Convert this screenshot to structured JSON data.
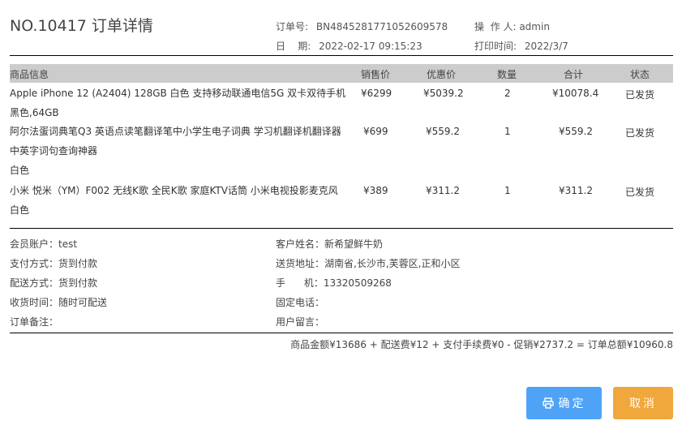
{
  "header": {
    "title": "NO.10417 订单详情",
    "order_no_label": "订单号:",
    "order_no": "BN4845281771052609578",
    "operator_label": "操  作 人:",
    "operator": "admin",
    "date_label": "日    期:",
    "date": "2022-02-17 09:15:23",
    "print_time_label": "打印时间:",
    "print_time": "2022/3/7"
  },
  "table": {
    "columns": [
      "商品信息",
      "销售价",
      "优惠价",
      "数量",
      "合计",
      "状态"
    ],
    "rows": [
      {
        "product_line1": "Apple iPhone 12 (A2404) 128GB 白色 支持移动联通电信5G 双卡双待手机",
        "product_line2": "黑色,64GB",
        "product_line3": "",
        "sale_price": "¥6299",
        "discount_price": "¥5039.2",
        "qty": "2",
        "total": "¥10078.4",
        "status": "已发货"
      },
      {
        "product_line1": "阿尔法蛋词典笔Q3 英语点读笔翻译笔中小学生电子词典 学习机翻译机翻译器",
        "product_line2": "中英字词句查询神器",
        "product_line3": "白色",
        "sale_price": "¥699",
        "discount_price": "¥559.2",
        "qty": "1",
        "total": "¥559.2",
        "status": "已发货"
      },
      {
        "product_line1": "小米 悦米（YM）F002 无线K歌 全民K歌 家庭KTV话筒 小米电视投影麦克风",
        "product_line2": "白色",
        "product_line3": "",
        "sale_price": "¥389",
        "discount_price": "¥311.2",
        "qty": "1",
        "total": "¥311.2",
        "status": "已发货"
      }
    ]
  },
  "info": {
    "member_account": "会员账户：test",
    "customer_name": "客户姓名：新希望鲜牛奶",
    "payment_method": "支付方式：货到付款",
    "address": "送货地址：湖南省,长沙市,芙蓉区,正和小区",
    "delivery_method": "配送方式：货到付款",
    "mobile_label": "手      机：",
    "mobile": "13320509268",
    "receive_time": "收货时间：随时可配送",
    "phone": "固定电话：",
    "order_note": "订单备注：",
    "user_message": "用户留言："
  },
  "summary": "商品金额¥13686 + 配送费¥12 + 支付手续费¥0 - 促销¥2737.2 = 订单总额¥10960.8",
  "buttons": {
    "confirm": "确定",
    "cancel": "取消"
  },
  "icons": {
    "confirm_icon": "printer-icon"
  }
}
